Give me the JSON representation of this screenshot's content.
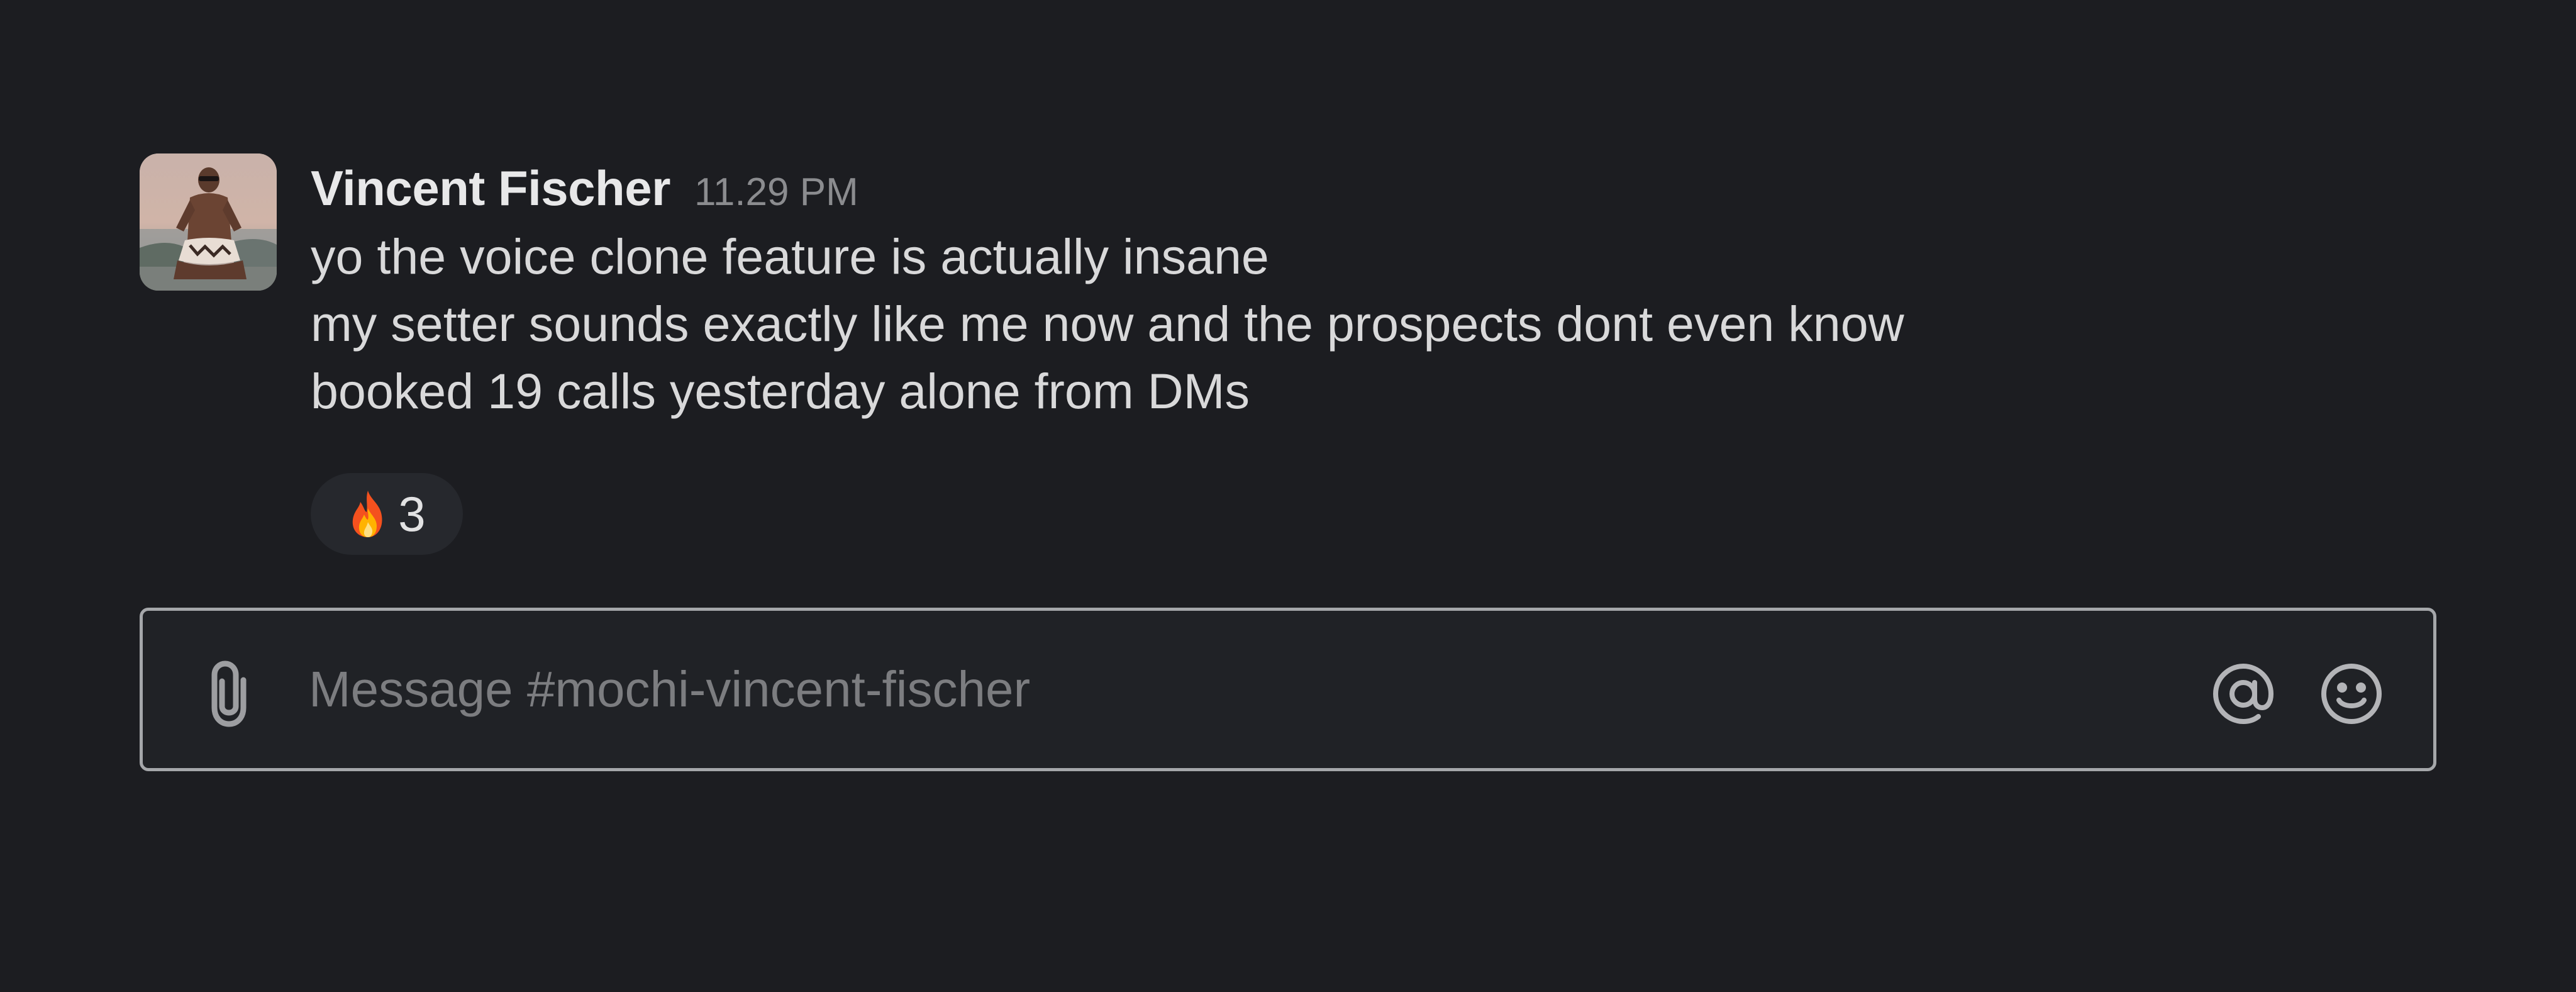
{
  "message": {
    "author": "Vincent Fischer",
    "timestamp": "11.29 PM",
    "lines": [
      "yo the voice clone feature is actually insane",
      "my setter sounds exactly like me now and the prospects dont even know",
      "booked 19 calls yesterday alone from DMs"
    ],
    "reaction": {
      "emoji": "fire-icon",
      "count": "3"
    }
  },
  "composer": {
    "placeholder": "Message #mochi-vincent-fischer",
    "icons": {
      "attach": "paperclip-icon",
      "mention": "at-sign-icon",
      "emoji": "smiley-icon"
    }
  },
  "colors": {
    "background": "#1c1d21",
    "composer_border": "#a5a7aa",
    "reaction_pill": "#26282d",
    "text": "#d9d9da",
    "muted": "#8b8c8f"
  }
}
